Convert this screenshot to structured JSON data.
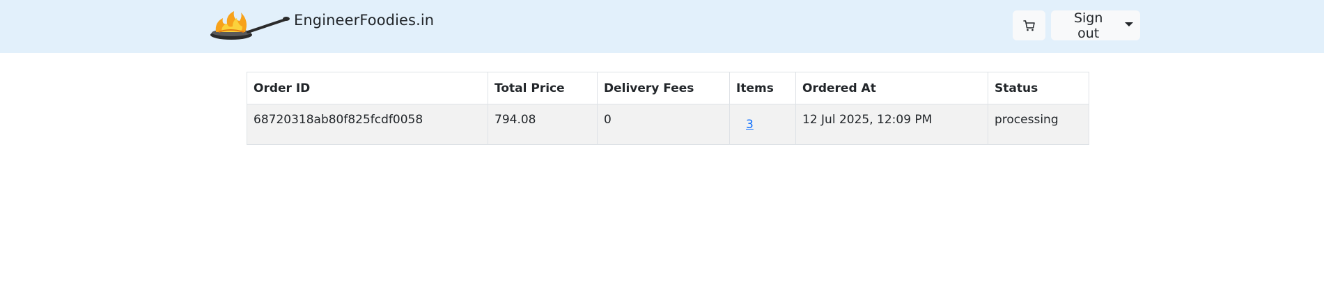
{
  "navbar": {
    "brand": "EngineerFoodies.in",
    "logo_icon": "frying-pan-flame-icon",
    "cart_icon": "cart-icon",
    "signout_label": "Sign out",
    "dropdown_icon": "caret-down-icon"
  },
  "orders": {
    "columns": [
      "Order ID",
      "Total Price",
      "Delivery Fees",
      "Items",
      "Ordered At",
      "Status"
    ],
    "rows": [
      {
        "order_id": "68720318ab80f825fcdf0058",
        "total_price": "794.08",
        "delivery_fees": "0",
        "items": "3",
        "ordered_at": "12 Jul 2025, 12:09 PM",
        "status": "processing"
      }
    ]
  },
  "colors": {
    "navbar_bg": "#e2f0fb",
    "button_bg": "#f8f9fa",
    "row_bg": "#f2f2f2",
    "link": "#0d6efd"
  }
}
